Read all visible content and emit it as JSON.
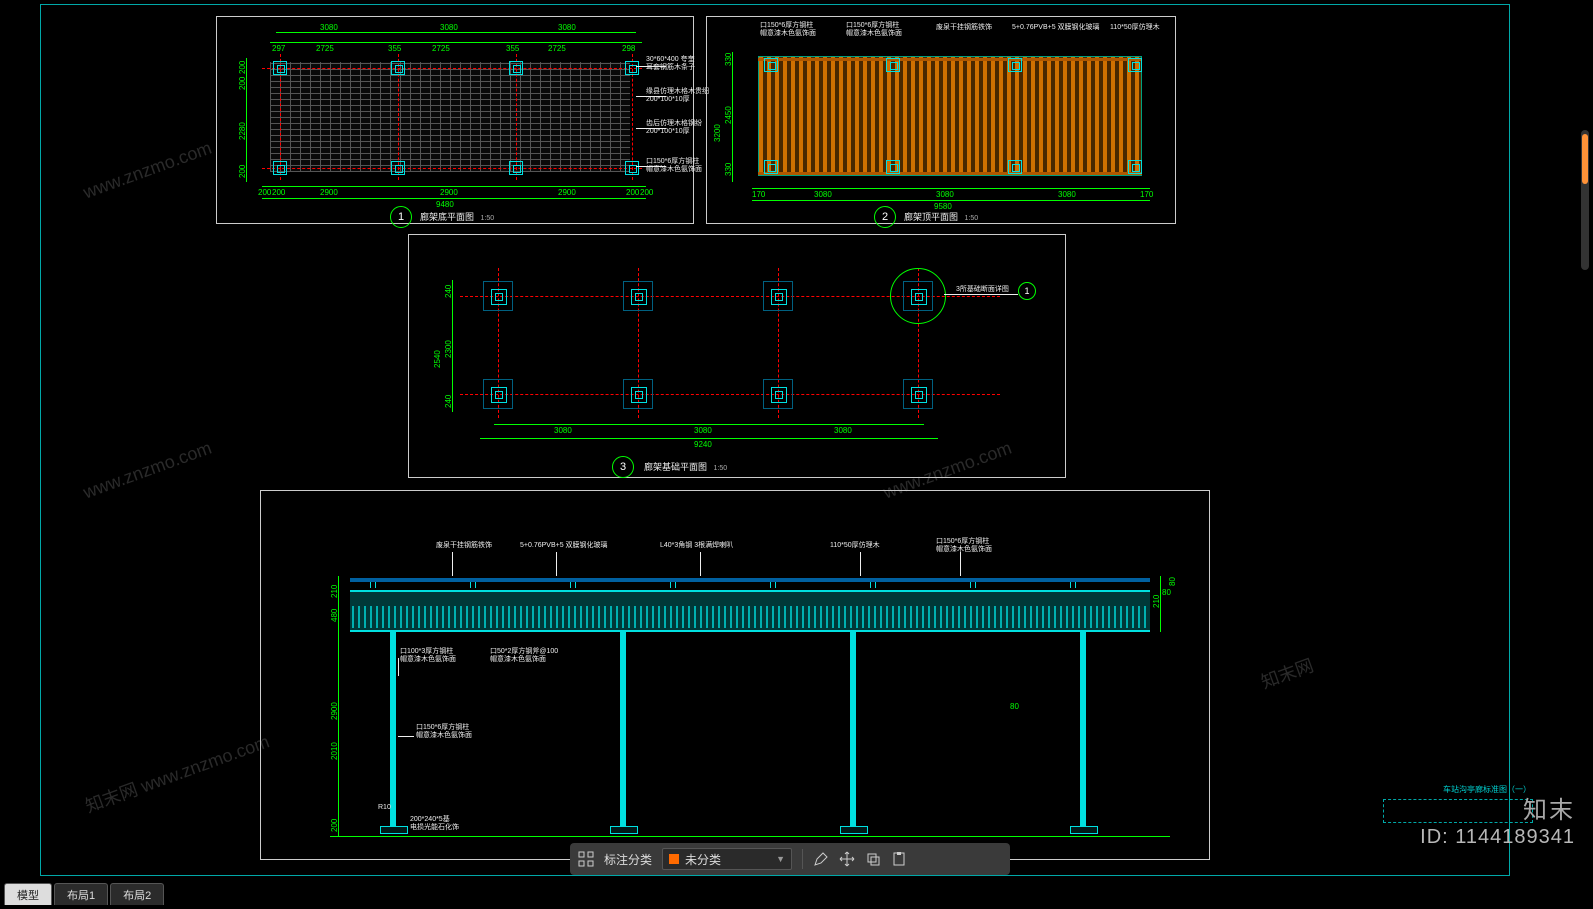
{
  "sheet": {
    "title_right": "车站沟亭廊标准图（一）",
    "id_label": "ID: 1144189341",
    "brand": "知末"
  },
  "views": {
    "v1": {
      "balloon": "1",
      "title": "廊架底平面图",
      "scale": "1:50"
    },
    "v2": {
      "balloon": "2",
      "title": "廊架顶平面图",
      "scale": "1:50"
    },
    "v3": {
      "balloon": "3",
      "title": "廊架基础平面图",
      "scale": "1:50"
    },
    "v4": {
      "balloon": "",
      "title": "",
      "scale": ""
    }
  },
  "dims": {
    "v1_top": [
      "3080",
      "3080",
      "3080"
    ],
    "v1_topB": [
      "297",
      "2725",
      "355",
      "2725",
      "355",
      "2725",
      "298"
    ],
    "v1_bot": [
      "200",
      "200",
      "2900",
      "2900",
      "2900",
      "200",
      "200"
    ],
    "v1_tot": "9480",
    "v1_left": [
      "200",
      "200",
      "2280",
      "200"
    ],
    "v2_bot": [
      "170",
      "3080",
      "3080",
      "3080",
      "170"
    ],
    "v2_tot": "9580",
    "v2_left": [
      "330",
      "2450",
      "3200",
      "330"
    ],
    "v3_bays": [
      "3080",
      "3080",
      "3080"
    ],
    "v3_tot": "9240",
    "v3_left": [
      "240",
      "2300",
      "2540",
      "240"
    ],
    "v4_left": [
      "200",
      "2900",
      "2010",
      "480",
      "210"
    ],
    "v4_top": "80"
  },
  "annos": {
    "v1": [
      "30*60*400 夸奎\n耳套钢筋木条子",
      "缘县仿理木格木贵细\n200*100*10厚",
      "齿后仿理木格钢纷\n200*100*10厚",
      "口150*6厚方钢柱\n帽意漆木色氨饰面"
    ],
    "v2": [
      "口150*6厚方钢柱\n帽意漆木色氨饰面",
      "口150*6厚方钢柱\n帽意漆木色氨饰面",
      "废泉干挂钢筋铁饰",
      "5+0.76PVB+5 双膜钢化玻璃",
      "110*50厚仿理木"
    ],
    "v3_det": "3所基础断面详图",
    "v4": [
      "废泉干挂钢筋铁饰",
      "5+0.76PVB+5 双膜钢化玻璃",
      "L40*3角钢 3根满焊喇叭",
      "110*50厚仿理木",
      "口150*6厚方钢柱\n帽意漆木色氨饰面",
      "口100*3厚方钢柱\n帽意漆木色氨饰面",
      "口50*2厚方钢斧@100\n帽意漆木色氨饰面",
      "口150*6厚方钢柱\n帽意漆木色氨饰面",
      "R10",
      "200*240*5基\n电损光能石化饰"
    ]
  },
  "toolbar": {
    "label": "标注分类",
    "dd_text": "未分类"
  },
  "tabs": [
    "模型",
    "布局1",
    "布局2"
  ]
}
